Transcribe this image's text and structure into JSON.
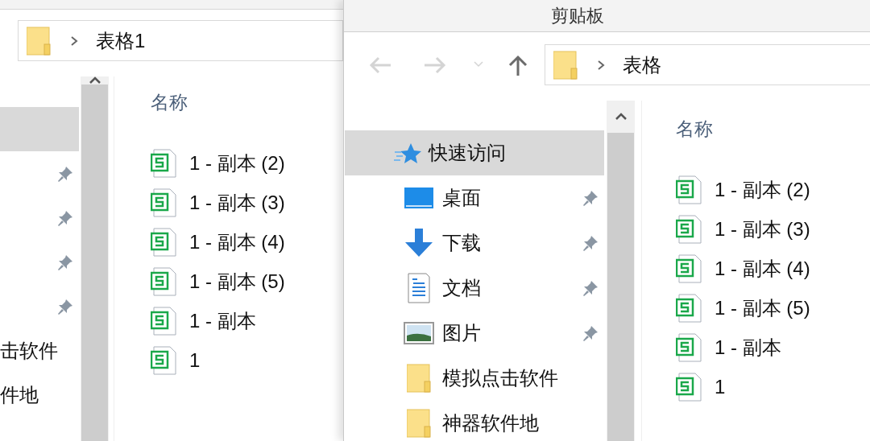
{
  "windows": [
    {
      "address": {
        "path": "表格1"
      },
      "sidebar": {
        "items": [
          {
            "selected": true,
            "pinned": false
          },
          {
            "selected": false,
            "pinned": true
          },
          {
            "selected": false,
            "pinned": true
          },
          {
            "selected": false,
            "pinned": true
          },
          {
            "selected": false,
            "pinned": true
          },
          {
            "label": "击软件",
            "selected": false,
            "pinned": false
          },
          {
            "label": "件地",
            "selected": false,
            "pinned": false
          }
        ]
      },
      "column": "名称",
      "files": [
        {
          "name": "1 - 副本 (2)"
        },
        {
          "name": "1 - 副本 (3)"
        },
        {
          "name": "1 - 副本 (4)"
        },
        {
          "name": "1 - 副本 (5)"
        },
        {
          "name": "1 - 副本"
        },
        {
          "name": "1"
        }
      ]
    },
    {
      "title": "剪贴板",
      "nav": [
        {
          "kind": "back",
          "disabled": true
        },
        {
          "kind": "forward",
          "disabled": true
        },
        {
          "kind": "recent",
          "disabled": true
        },
        {
          "kind": "up",
          "disabled": false
        }
      ],
      "address": {
        "path": "表格"
      },
      "sidebar": {
        "items": [
          {
            "kind": "quick-access",
            "label": "快速访问",
            "selected": true,
            "pinned": false
          },
          {
            "kind": "desktop",
            "label": "桌面",
            "selected": false,
            "pinned": true
          },
          {
            "kind": "download",
            "label": "下载",
            "selected": false,
            "pinned": true
          },
          {
            "kind": "document",
            "label": "文档",
            "selected": false,
            "pinned": true
          },
          {
            "kind": "pictures",
            "label": "图片",
            "selected": false,
            "pinned": true
          },
          {
            "kind": "folder",
            "label": "模拟点击软件",
            "selected": false,
            "pinned": false
          },
          {
            "kind": "folder",
            "label": "神器软件地",
            "selected": false,
            "pinned": false
          }
        ]
      },
      "column": "名称",
      "files": [
        {
          "name": "1 - 副本 (2)"
        },
        {
          "name": "1 - 副本 (3)"
        },
        {
          "name": "1 - 副本 (4)"
        },
        {
          "name": "1 - 副本 (5)"
        },
        {
          "name": "1 - 副本"
        },
        {
          "name": "1"
        }
      ]
    }
  ]
}
